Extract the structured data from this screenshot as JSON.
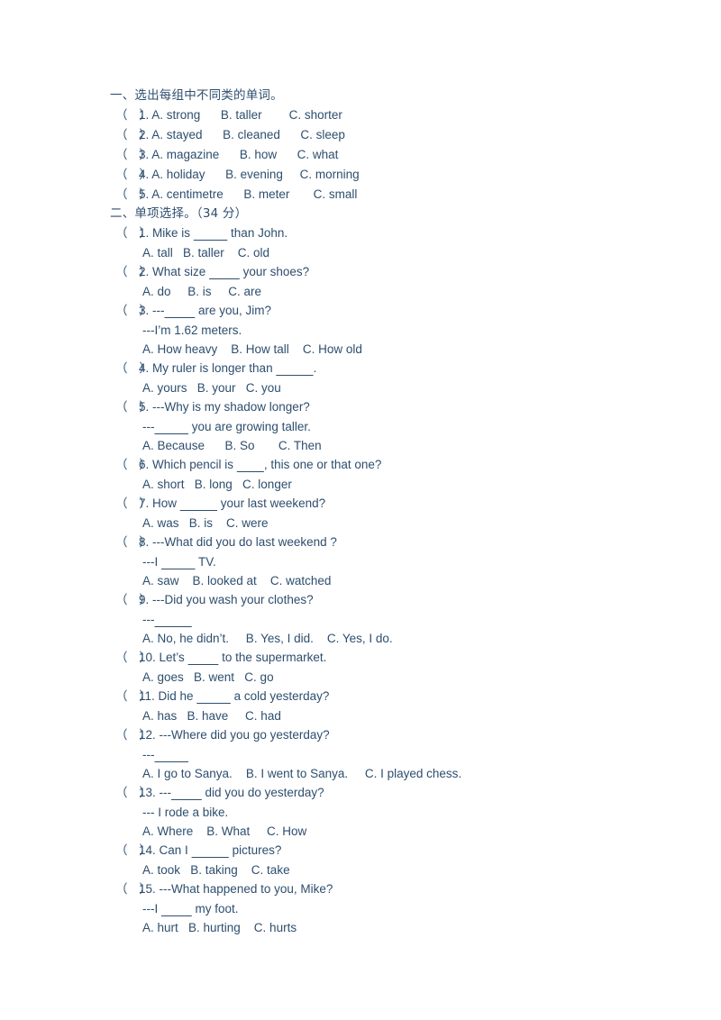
{
  "document": {
    "text_color": "#2d4e6e",
    "background_color": "#ffffff"
  },
  "sections": [
    {
      "id": "section-1",
      "heading": "一、选出每组中不同类的单词。",
      "questions": [
        {
          "marker": "（   ）",
          "number": "1.",
          "prompt": "A. strong",
          "lines": [],
          "options": "B. taller        C. shorter",
          "inline": true
        },
        {
          "marker": "（   ）",
          "number": "2.",
          "prompt": "A. stayed",
          "lines": [],
          "options": "B. cleaned      C. sleep",
          "inline": true
        },
        {
          "marker": "（   ）",
          "number": "3.",
          "prompt": "A. magazine",
          "lines": [],
          "options": "B. how      C. what",
          "inline": true
        },
        {
          "marker": "（   ）",
          "number": "4.",
          "prompt": "A. holiday",
          "lines": [],
          "options": "B. evening     C. morning",
          "inline": true
        },
        {
          "marker": "（   ）",
          "number": "5.",
          "prompt": "A. centimetre",
          "lines": [],
          "options": "B. meter       C. small",
          "inline": true
        }
      ]
    },
    {
      "id": "section-2",
      "heading": "二、单项选择。（34 分）",
      "questions": [
        {
          "marker": "（   ）",
          "number": "1.",
          "stem_before": "Mike is ",
          "stem_blank": "__________",
          "stem_after": " than John.",
          "lines": [],
          "options": "A. tall   B. taller    C. old"
        },
        {
          "marker": "（   ）",
          "number": "2.",
          "stem_before": "What size ",
          "stem_blank": "_________",
          "stem_after": " your shoes?",
          "lines": [],
          "options": "A. do     B. is     C. are"
        },
        {
          "marker": "（   ）",
          "number": "3.",
          "stem_before": "---",
          "stem_blank": "_________",
          "stem_after": " are you, Jim?",
          "lines": [
            "---I’m 1.62 meters."
          ],
          "options": "A. How heavy    B. How tall    C. How old"
        },
        {
          "marker": "（   ）",
          "number": "4.",
          "stem_before": "My ruler is longer than ",
          "stem_blank": "___________",
          "stem_after": ".",
          "lines": [],
          "options": "A. yours   B. your   C. you"
        },
        {
          "marker": "（   ）",
          "number": "5.",
          "stem_before": "---Why is my shadow longer?",
          "stem_blank": "",
          "stem_after": "",
          "lines": [
            "---__________ you are growing taller."
          ],
          "options": "A. Because      B. So       C. Then"
        },
        {
          "marker": "（   ）",
          "number": "6.",
          "stem_before": "Which pencil is ",
          "stem_blank": "________",
          "stem_after": ", this one or that one?",
          "lines": [],
          "options": "A. short   B. long   C. longer"
        },
        {
          "marker": "（   ）",
          "number": "7.",
          "stem_before": "How ",
          "stem_blank": "___________",
          "stem_after": " your last weekend?",
          "lines": [],
          "options": "A. was   B. is    C. were"
        },
        {
          "marker": "（   ）",
          "number": "8.",
          "stem_before": "---What did you do last weekend ?",
          "stem_blank": "",
          "stem_after": "",
          "lines": [
            "---I __________ TV."
          ],
          "options": "A. saw    B. looked at    C. watched"
        },
        {
          "marker": "（   ）",
          "number": "9.",
          "stem_before": "---Did you wash your clothes?",
          "stem_blank": "",
          "stem_after": "",
          "lines": [
            "---___________"
          ],
          "options": "A. No, he didn’t.     B. Yes, I did.    C. Yes, I do."
        },
        {
          "marker": "（   ）",
          "number": "10.",
          "stem_before": "Let’s ",
          "stem_blank": "_________",
          "stem_after": " to the supermarket.",
          "lines": [],
          "options": "A. goes   B. went   C. go"
        },
        {
          "marker": "（   ）",
          "number": "11.",
          "stem_before": "Did he ",
          "stem_blank": "__________",
          "stem_after": " a cold yesterday?",
          "lines": [],
          "options": "A. has   B. have     C. had"
        },
        {
          "marker": "（   ）",
          "number": "12.",
          "stem_before": "---Where did you go yesterday?",
          "stem_blank": "",
          "stem_after": "",
          "lines": [
            "---__________"
          ],
          "options": "A. I go to Sanya.    B. I went to Sanya.     C. I played chess."
        },
        {
          "marker": "（   ）",
          "number": "13.",
          "stem_before": "---",
          "stem_blank": "_________",
          "stem_after": " did you do yesterday?",
          "lines": [
            "--- I rode a bike."
          ],
          "options": "A. Where    B. What     C. How"
        },
        {
          "marker": "（   ）",
          "number": "14.",
          "stem_before": "Can I ",
          "stem_blank": "___________",
          "stem_after": " pictures?",
          "lines": [],
          "options": "A. took   B. taking    C. take"
        },
        {
          "marker": "（   ）",
          "number": "15.",
          "stem_before": "---What happened to you, Mike?",
          "stem_blank": "",
          "stem_after": "",
          "lines": [
            "---I _________ my foot."
          ],
          "options": "A. hurt   B. hurting    C. hurts"
        }
      ]
    }
  ]
}
